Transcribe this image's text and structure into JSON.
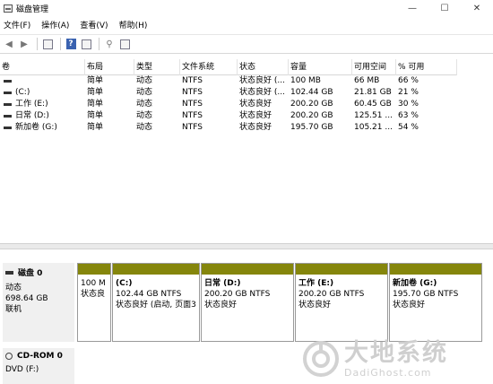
{
  "window": {
    "title": "磁盘管理",
    "controls": [
      "—",
      "☐",
      "✕"
    ]
  },
  "menubar": {
    "items": [
      "文件(F)",
      "操作(A)",
      "查看(V)",
      "帮助(H)"
    ]
  },
  "toolbar": {
    "icons": [
      "back-arrow-icon",
      "forward-arrow-icon",
      "view-icon",
      "help-icon",
      "properties-icon",
      "connect-icon",
      "list-icon"
    ]
  },
  "volume_table": {
    "columns": [
      "卷",
      "布局",
      "类型",
      "文件系统",
      "状态",
      "容量",
      "可用空间",
      "% 可用"
    ],
    "rows": [
      [
        "",
        "简单",
        "动态",
        "NTFS",
        "状态良好 (...",
        "100 MB",
        "66 MB",
        "66 %"
      ],
      [
        "(C:)",
        "简单",
        "动态",
        "NTFS",
        "状态良好 (...",
        "102.44 GB",
        "21.81 GB",
        "21 %"
      ],
      [
        "工作 (E:)",
        "简单",
        "动态",
        "NTFS",
        "状态良好",
        "200.20 GB",
        "60.45 GB",
        "30 %"
      ],
      [
        "日常 (D:)",
        "简单",
        "动态",
        "NTFS",
        "状态良好",
        "200.20 GB",
        "125.51 ...",
        "63 %"
      ],
      [
        "新加卷 (G:)",
        "简单",
        "动态",
        "NTFS",
        "状态良好",
        "195.70 GB",
        "105.21 ...",
        "54 %"
      ]
    ]
  },
  "disk0": {
    "name": "磁盘 0",
    "type": "动态",
    "size": "698.64 GB",
    "status": "联机",
    "partitions": [
      {
        "name": "",
        "line1": "100 M",
        "line2": "状态良"
      },
      {
        "name": "(C:)",
        "line1": "102.44 GB NTFS",
        "line2": "状态良好 (启动, 页面3"
      },
      {
        "name": "日常  (D:)",
        "line1": "200.20 GB NTFS",
        "line2": "状态良好"
      },
      {
        "name": "工作  (E:)",
        "line1": "200.20 GB NTFS",
        "line2": "状态良好"
      },
      {
        "name": "新加卷  (G:)",
        "line1": "195.70 GB NTFS",
        "line2": "状态良好"
      }
    ]
  },
  "cdrom": {
    "name": "CD-ROM 0",
    "drive": "DVD (F:)"
  },
  "watermark": {
    "main": "大地系统",
    "sub": "DadiGhost.com"
  },
  "colors": {
    "partition_bar": "#85860c",
    "help_icon": "#3a62b0"
  }
}
